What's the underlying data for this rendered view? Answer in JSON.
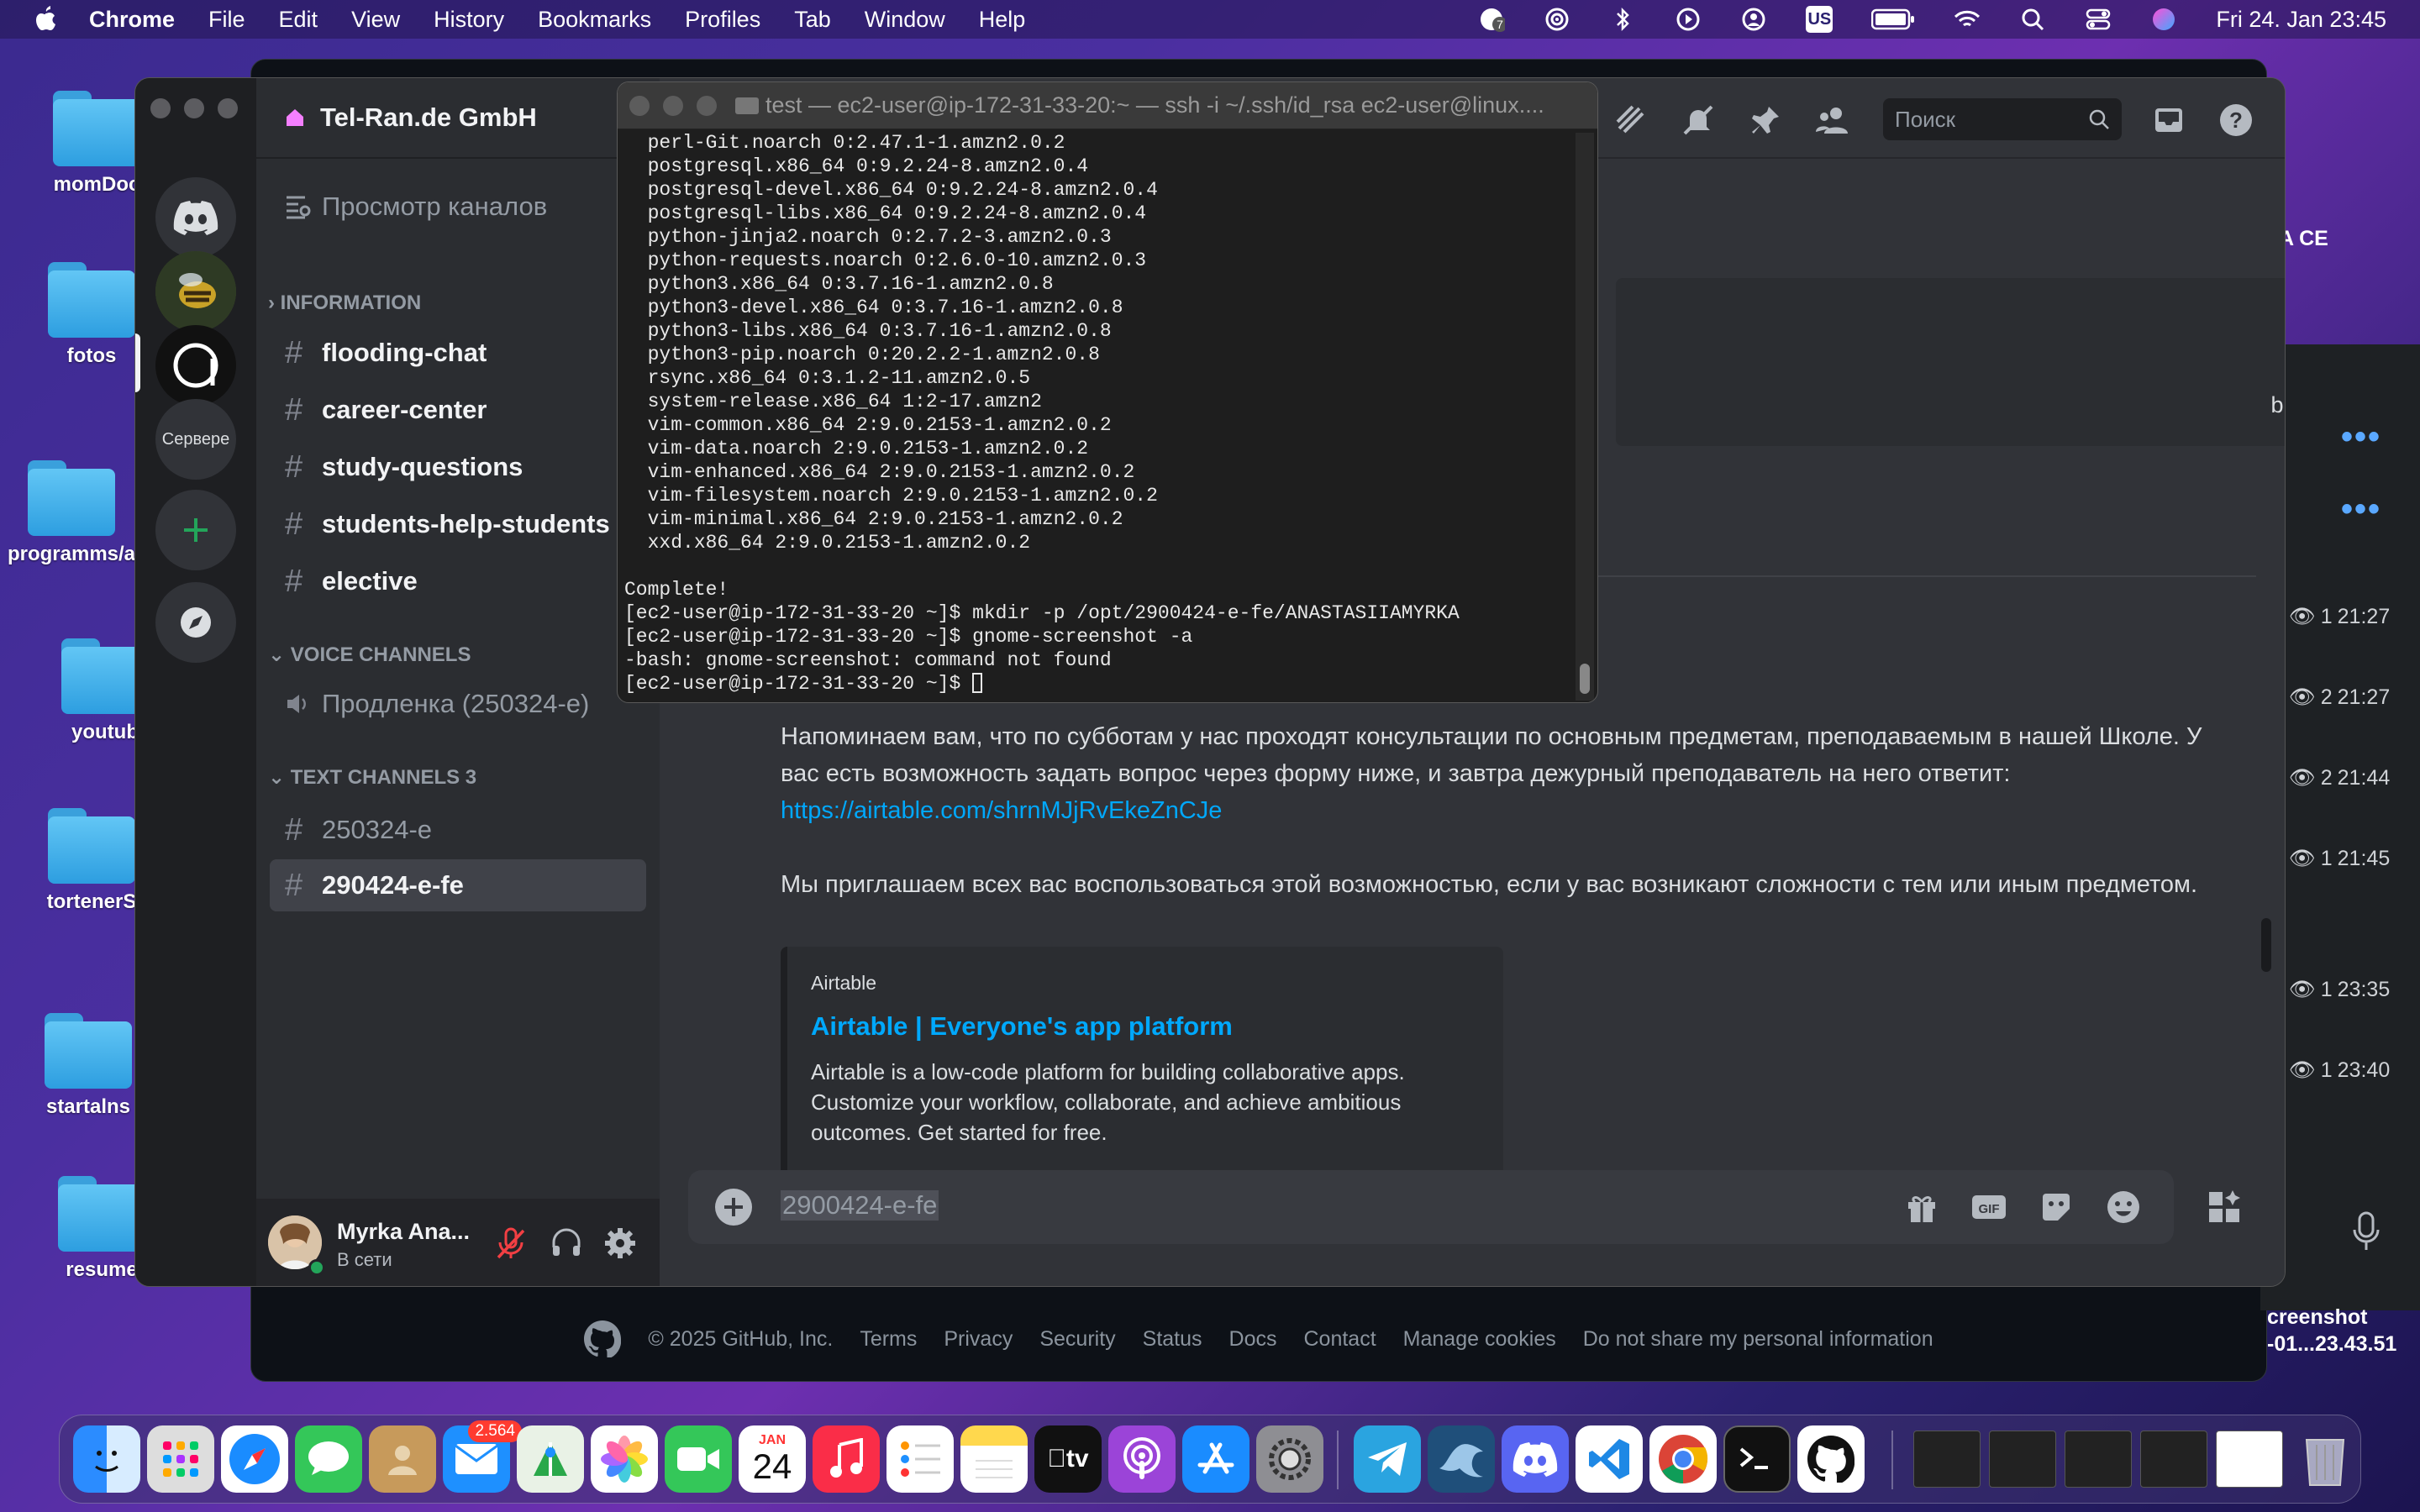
{
  "menubar": {
    "app_name": "Chrome",
    "items": [
      "File",
      "Edit",
      "View",
      "History",
      "Bookmarks",
      "Profiles",
      "Tab",
      "Window",
      "Help"
    ],
    "status_icons": [
      "notifications-icon",
      "airdrop-icon",
      "bluetooth-icon",
      "play-icon",
      "user-icon",
      "keyboard-layout-icon",
      "battery-icon",
      "wifi-icon",
      "spotlight-icon",
      "control-center-icon",
      "siri-icon"
    ],
    "keyboard_layout": "US",
    "notification_count": "7",
    "clock": "Fri 24. Jan  23:45"
  },
  "desktop": {
    "icons": [
      {
        "label": "momDoc"
      },
      {
        "label": "fotos"
      },
      {
        "label": "programms/a"
      },
      {
        "label": "youtub"
      },
      {
        "label": "tortenerS"
      },
      {
        "label": "startalns"
      },
      {
        "label": "resume"
      }
    ],
    "right_label_top": "A CE",
    "screenshot_label_1": "creenshot",
    "screenshot_label_2": "-01...23.43.51"
  },
  "github_footer": {
    "copyright": "© 2025 GitHub, Inc.",
    "links": [
      "Terms",
      "Privacy",
      "Security",
      "Status",
      "Docs",
      "Contact",
      "Manage cookies",
      "Do not share my personal information"
    ]
  },
  "side_window": {
    "badges": [
      {
        "count": "1",
        "time": "21:27"
      },
      {
        "count": "2",
        "time": "21:27"
      },
      {
        "count": "2",
        "time": "21:44"
      },
      {
        "count": "1",
        "time": "21:45"
      },
      {
        "count": "1",
        "time": "23:35"
      },
      {
        "count": "1",
        "time": "23:40"
      }
    ]
  },
  "discord": {
    "server_name": "Tel-Ran.de GmbH",
    "browse_channels": "Просмотр каналов",
    "guild_text": "Сервере",
    "categories": {
      "information": "INFORMATION",
      "voice": "VOICE CHANNELS",
      "text": "TEXT CHANNELS 3"
    },
    "channels": [
      "flooding-chat",
      "career-center",
      "study-questions",
      "students-help-students",
      "elective"
    ],
    "voice_channel": "Продленка (250324-е)",
    "text_channels": [
      "250324-e",
      "290424-e-fe"
    ],
    "user": {
      "name": "Myrka Ana...",
      "status": "В сети"
    },
    "search_placeholder": "Поиск",
    "partial_text": "b.",
    "message": {
      "p1": "Напоминаем вам, что по субботам у нас проходят консультации по основным предметам, преподаваемым в нашей Школе. У вас есть возможность задать вопрос через форму ниже, и завтра дежурный преподаватель на него ответит:",
      "link": "https://airtable.com/shrnMJjRvEkeZnCJe",
      "p2": "Мы приглашаем всех вас воспользоваться этой возможностью, если у вас возникают сложности с тем или иным предметом."
    },
    "embed": {
      "provider": "Airtable",
      "title": "Airtable | Everyone's app platform",
      "description": "Airtable is a low-code platform for building collaborative apps. Customize your workflow, collaborate, and achieve ambitious outcomes. Get started for free."
    },
    "composer_text": "2900424-e-fe"
  },
  "terminal": {
    "title": "test — ec2-user@ip-172-31-33-20:~ — ssh -i ~/.ssh/id_rsa ec2-user@linux....",
    "lines": [
      "  perl-Git.noarch 0:2.47.1-1.amzn2.0.2",
      "  postgresql.x86_64 0:9.2.24-8.amzn2.0.4",
      "  postgresql-devel.x86_64 0:9.2.24-8.amzn2.0.4",
      "  postgresql-libs.x86_64 0:9.2.24-8.amzn2.0.4",
      "  python-jinja2.noarch 0:2.7.2-3.amzn2.0.3",
      "  python-requests.noarch 0:2.6.0-10.amzn2.0.3",
      "  python3.x86_64 0:3.7.16-1.amzn2.0.8",
      "  python3-devel.x86_64 0:3.7.16-1.amzn2.0.8",
      "  python3-libs.x86_64 0:3.7.16-1.amzn2.0.8",
      "  python3-pip.noarch 0:20.2.2-1.amzn2.0.8",
      "  rsync.x86_64 0:3.1.2-11.amzn2.0.5",
      "  system-release.x86_64 1:2-17.amzn2",
      "  vim-common.x86_64 2:9.0.2153-1.amzn2.0.2",
      "  vim-data.noarch 2:9.0.2153-1.amzn2.0.2",
      "  vim-enhanced.x86_64 2:9.0.2153-1.amzn2.0.2",
      "  vim-filesystem.noarch 2:9.0.2153-1.amzn2.0.2",
      "  vim-minimal.x86_64 2:9.0.2153-1.amzn2.0.2",
      "  xxd.x86_64 2:9.0.2153-1.amzn2.0.2",
      "",
      "Complete!",
      "[ec2-user@ip-172-31-33-20 ~]$ mkdir -p /opt/2900424-e-fe/ANASTASIIAMYRKA",
      "[ec2-user@ip-172-31-33-20 ~]$ gnome-screenshot -a",
      "-bash: gnome-screenshot: command not found",
      "[ec2-user@ip-172-31-33-20 ~]$ "
    ]
  },
  "dock": {
    "calendar_month": "JAN",
    "calendar_day": "24",
    "mail_badge": "2.564",
    "tv_label": "tv"
  }
}
